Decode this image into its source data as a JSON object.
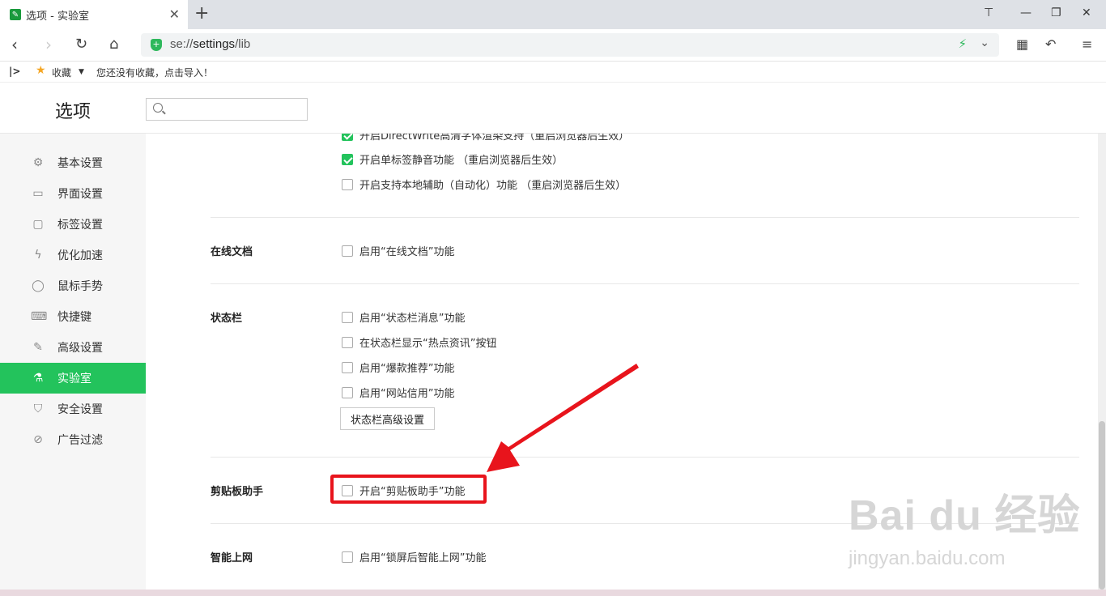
{
  "tab": {
    "title": "选项 - 实验室",
    "icon": "wrench-icon"
  },
  "nav": {
    "url_prefix": "se://",
    "url_host": "settings",
    "url_path": "/lib"
  },
  "bookmarks": {
    "label": "收藏",
    "empty_text": "您还没有收藏，点击导入！"
  },
  "header": {
    "title": "选项",
    "search_placeholder": ""
  },
  "sidebar": {
    "items": [
      {
        "label": "基本设置",
        "icon": "gear-icon"
      },
      {
        "label": "界面设置",
        "icon": "window-icon"
      },
      {
        "label": "标签设置",
        "icon": "tab-icon"
      },
      {
        "label": "优化加速",
        "icon": "lightning-icon"
      },
      {
        "label": "鼠标手势",
        "icon": "mouse-icon"
      },
      {
        "label": "快捷键",
        "icon": "keyboard-icon"
      },
      {
        "label": "高级设置",
        "icon": "wrench-icon"
      },
      {
        "label": "实验室",
        "icon": "flask-icon"
      },
      {
        "label": "安全设置",
        "icon": "shield-icon"
      },
      {
        "label": "广告过滤",
        "icon": "block-icon"
      }
    ],
    "active": "实验室"
  },
  "main": {
    "top_options": [
      {
        "label": "开启DirectWrite高清字体渲染支持（重启浏览器后生效）",
        "checked": true
      },
      {
        "label": "开启单标签静音功能 （重启浏览器后生效）",
        "checked": true
      },
      {
        "label": "开启支持本地辅助（自动化）功能 （重启浏览器后生效）",
        "checked": false
      }
    ],
    "online_docs": {
      "title": "在线文档",
      "option": "启用“在线文档”功能"
    },
    "statusbar": {
      "title": "状态栏",
      "options": [
        "启用“状态栏消息”功能",
        "在状态栏显示“热点资讯”按钮",
        "启用“爆款推荐”功能",
        "启用“网站信用”功能"
      ],
      "button": "状态栏高级设置"
    },
    "clipboard": {
      "title": "剪贴板助手",
      "option": "开启“剪贴板助手”功能"
    },
    "smart_net": {
      "title": "智能上网",
      "option": "启用“锁屏后智能上网”功能"
    }
  },
  "watermark": {
    "brand": "Bai du 经验",
    "site": "jingyan.baidu.com"
  },
  "colors": {
    "accent": "#23c35c",
    "highlight": "#e8141c"
  }
}
